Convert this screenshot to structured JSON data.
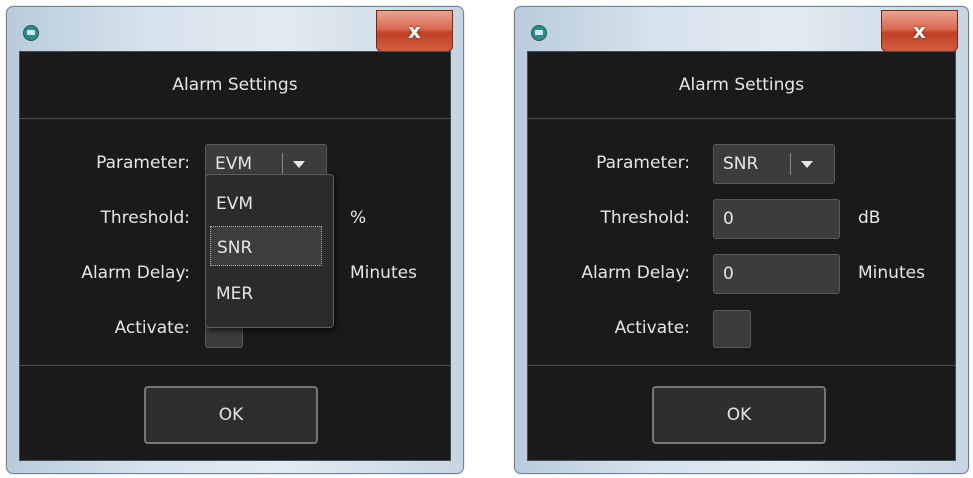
{
  "close_label": "x",
  "dialogs": [
    {
      "title": "Alarm Settings",
      "parameter_label": "Parameter:",
      "parameter_value": "EVM",
      "threshold_label": "Threshold:",
      "threshold_value": "",
      "threshold_unit": "%",
      "delay_label": "Alarm Delay:",
      "delay_value": "",
      "delay_unit": "Minutes",
      "activate_label": "Activate:",
      "ok_label": "OK",
      "dropdown_options": [
        "EVM",
        "SNR",
        "MER"
      ],
      "dropdown_highlighted": "SNR"
    },
    {
      "title": "Alarm Settings",
      "parameter_label": "Parameter:",
      "parameter_value": "SNR",
      "threshold_label": "Threshold:",
      "threshold_value": "0",
      "threshold_unit": "dB",
      "delay_label": "Alarm Delay:",
      "delay_value": "0",
      "delay_unit": "Minutes",
      "activate_label": "Activate:",
      "ok_label": "OK"
    }
  ],
  "colors": {
    "client_bg": "#1a1a1a",
    "control_bg": "#3c3c3c",
    "text": "#e6e6e6",
    "close_button": "#c14025"
  },
  "icons": {
    "app": "app-monitor-icon",
    "close": "close-icon",
    "dropdown": "chevron-down-icon"
  }
}
